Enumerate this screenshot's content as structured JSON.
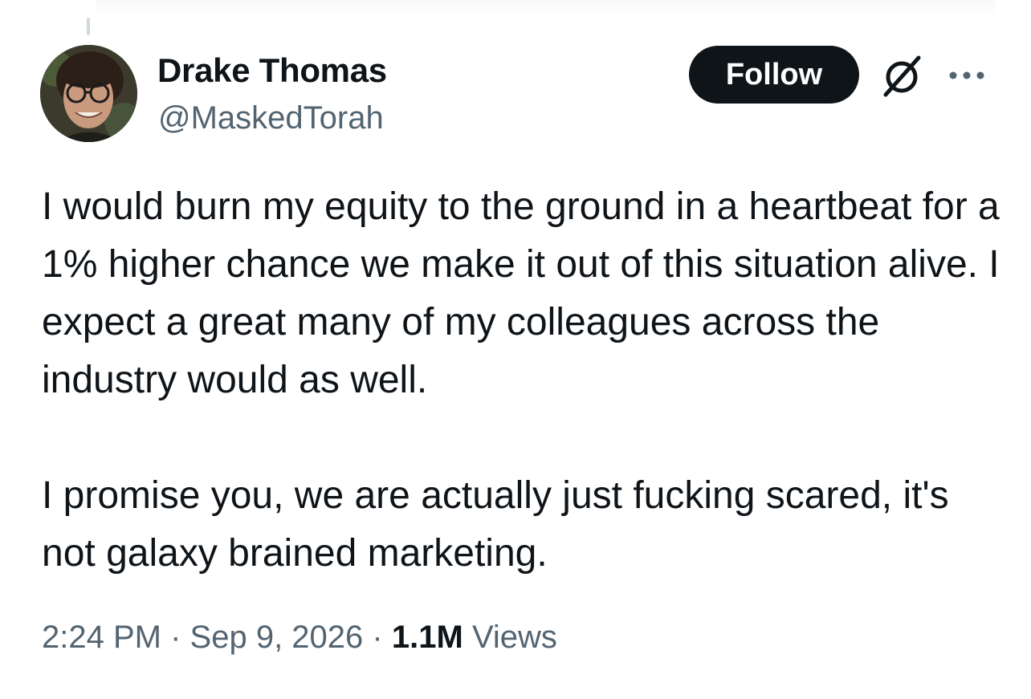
{
  "author": {
    "display_name": "Drake Thomas",
    "handle": "@MaskedTorah"
  },
  "actions": {
    "follow_label": "Follow",
    "grok_icon": "grok-icon",
    "more_icon": "more-icon"
  },
  "tweet": {
    "paragraphs": [
      "I would burn my equity to the ground in a heartbeat for a 1% higher chance we make it out of this situation alive. I expect a great many of my colleagues across the industry would as well.",
      "I promise you, we are actually just fucking scared, it's not galaxy brained marketing."
    ]
  },
  "meta": {
    "time": "2:24 PM",
    "separator": "·",
    "date": "Sep 9, 2026",
    "views_count": "1.1M",
    "views_label": "Views"
  },
  "colors": {
    "text_primary": "#0f1419",
    "text_secondary": "#536471",
    "follow_bg": "#0f1419",
    "thread_line": "#cfd9de"
  }
}
